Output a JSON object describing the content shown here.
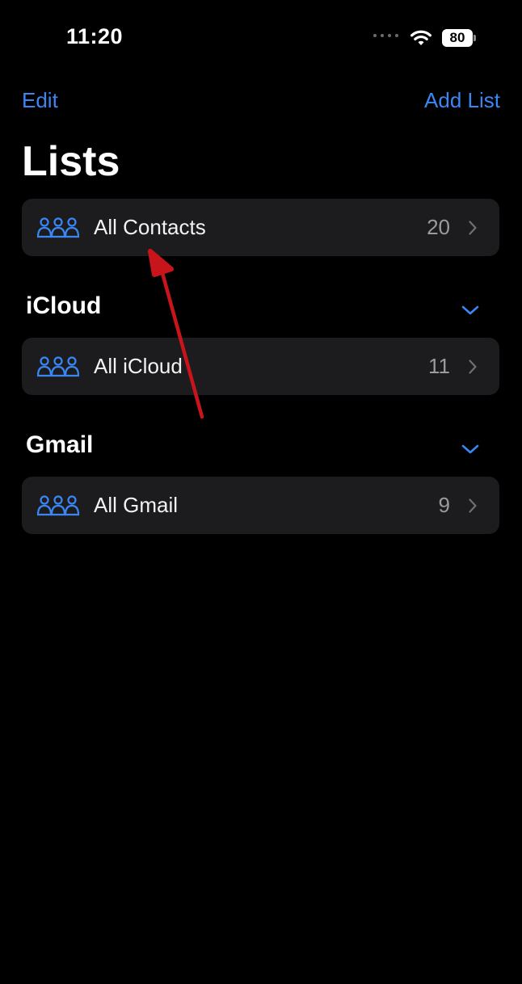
{
  "status_bar": {
    "time": "11:20",
    "battery": "80"
  },
  "nav": {
    "edit_label": "Edit",
    "add_list_label": "Add List"
  },
  "title": "Lists",
  "all_contacts": {
    "label": "All Contacts",
    "count": "20"
  },
  "sections": [
    {
      "title": "iCloud",
      "item": {
        "label": "All iCloud",
        "count": "11"
      }
    },
    {
      "title": "Gmail",
      "item": {
        "label": "All Gmail",
        "count": "9"
      }
    }
  ],
  "icons": {
    "group": "three-people-icon",
    "chevron": "chevron-right-icon",
    "toggle": "chevron-down-icon",
    "wifi": "wifi-icon"
  },
  "colors": {
    "accent": "#3a86f5",
    "background": "#000000",
    "card": "#1c1c1e",
    "annotation_arrow": "#c8141b"
  }
}
